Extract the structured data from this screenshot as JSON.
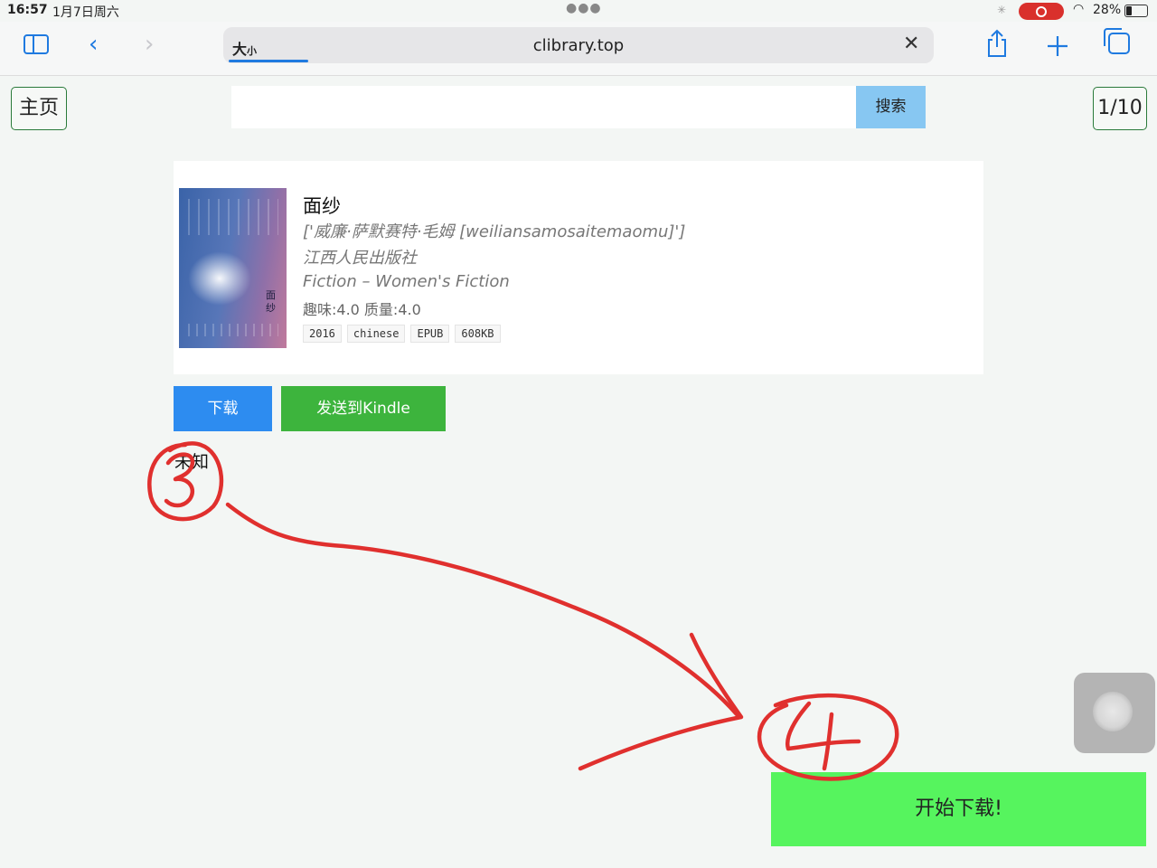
{
  "status_bar": {
    "time": "16:57",
    "date": "1月7日周六",
    "battery": "28%"
  },
  "browser": {
    "reader_label": "大",
    "reader_label_small": "小",
    "url": "clibrary.top"
  },
  "nav": {
    "home_label": "主页",
    "page_indicator": "1/10"
  },
  "search": {
    "button_label": "搜索",
    "value": "",
    "placeholder": ""
  },
  "book": {
    "cover_title": "面纱",
    "title": "面纱",
    "author": "['威廉·萨默赛特·毛姆 [weiliansamosaitemaomu]']",
    "publisher": "江西人民出版社",
    "category": "Fiction – Women's Fiction",
    "rating": "趣味:4.0 质量:4.0",
    "tags": [
      "2016",
      "chinese",
      "EPUB",
      "608KB"
    ]
  },
  "actions": {
    "download_label": "下载",
    "kindle_label": "发送到Kindle",
    "status_text": "未知",
    "start_download_label": "开始下载!"
  },
  "annotations": {
    "color": "#e0302e",
    "step_a": "3",
    "step_b": "4"
  }
}
